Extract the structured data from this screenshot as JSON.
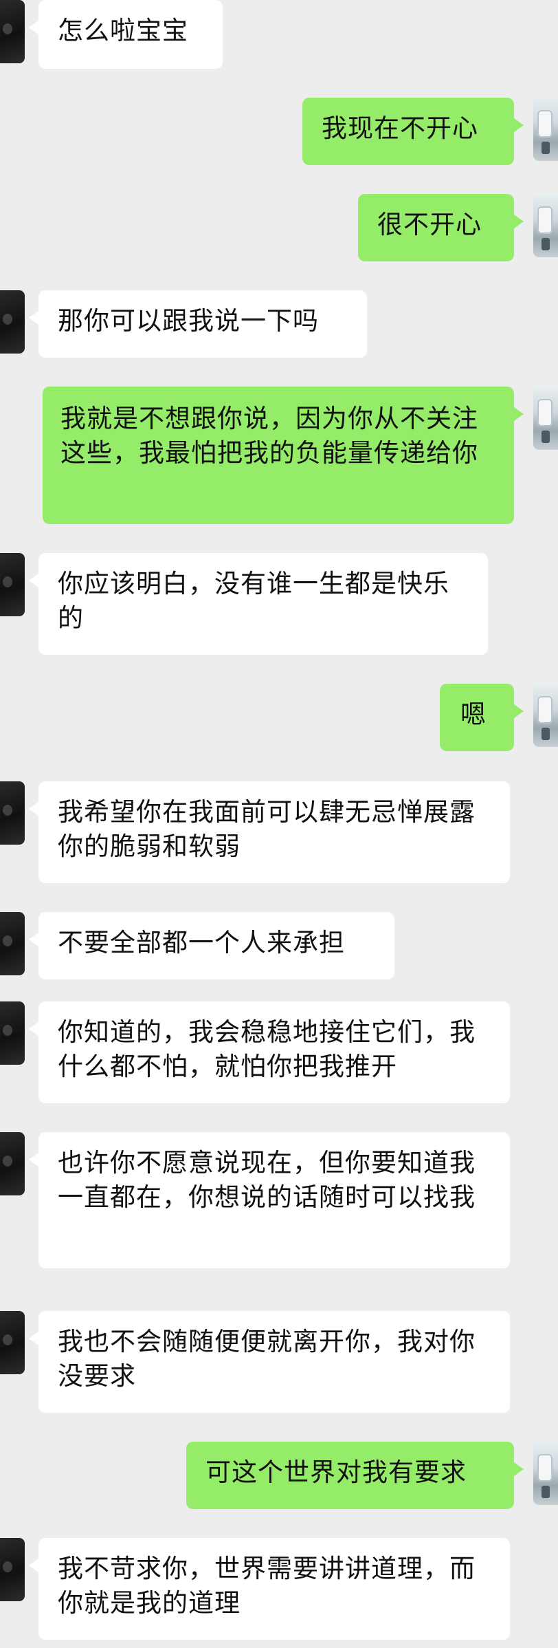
{
  "conversation": {
    "messages": [
      {
        "side": "left",
        "text": "怎么啦宝宝"
      },
      {
        "side": "right",
        "text": "我现在不开心"
      },
      {
        "side": "right",
        "text": "很不开心"
      },
      {
        "side": "left",
        "text": "那你可以跟我说一下吗"
      },
      {
        "side": "right",
        "text": "我就是不想跟你说，因为你从不关注这些，我最怕把我的负能量传递给你"
      },
      {
        "side": "left",
        "text": "你应该明白，没有谁一生都是快乐的"
      },
      {
        "side": "right",
        "text": "嗯"
      },
      {
        "side": "left",
        "text": "我希望你在我面前可以肆无忌惮展露你的脆弱和软弱"
      },
      {
        "side": "left",
        "text": "不要全部都一个人来承担"
      },
      {
        "side": "left",
        "text": "你知道的，我会稳稳地接住它们，我什么都不怕，就怕你把我推开"
      },
      {
        "side": "left",
        "text": "也许你不愿意说现在，但你要知道我一直都在，你想说的话随时可以找我"
      },
      {
        "side": "left",
        "text": "我也不会随随便便就离开你，我对你没要求"
      },
      {
        "side": "right",
        "text": "可这个世界对我有要求"
      },
      {
        "side": "left",
        "text": "我不苛求你，世界需要讲讲道理，而你就是我的道理"
      }
    ]
  },
  "colors": {
    "background": "#ededed",
    "incoming_bubble": "#ffffff",
    "outgoing_bubble": "#95ec69"
  }
}
